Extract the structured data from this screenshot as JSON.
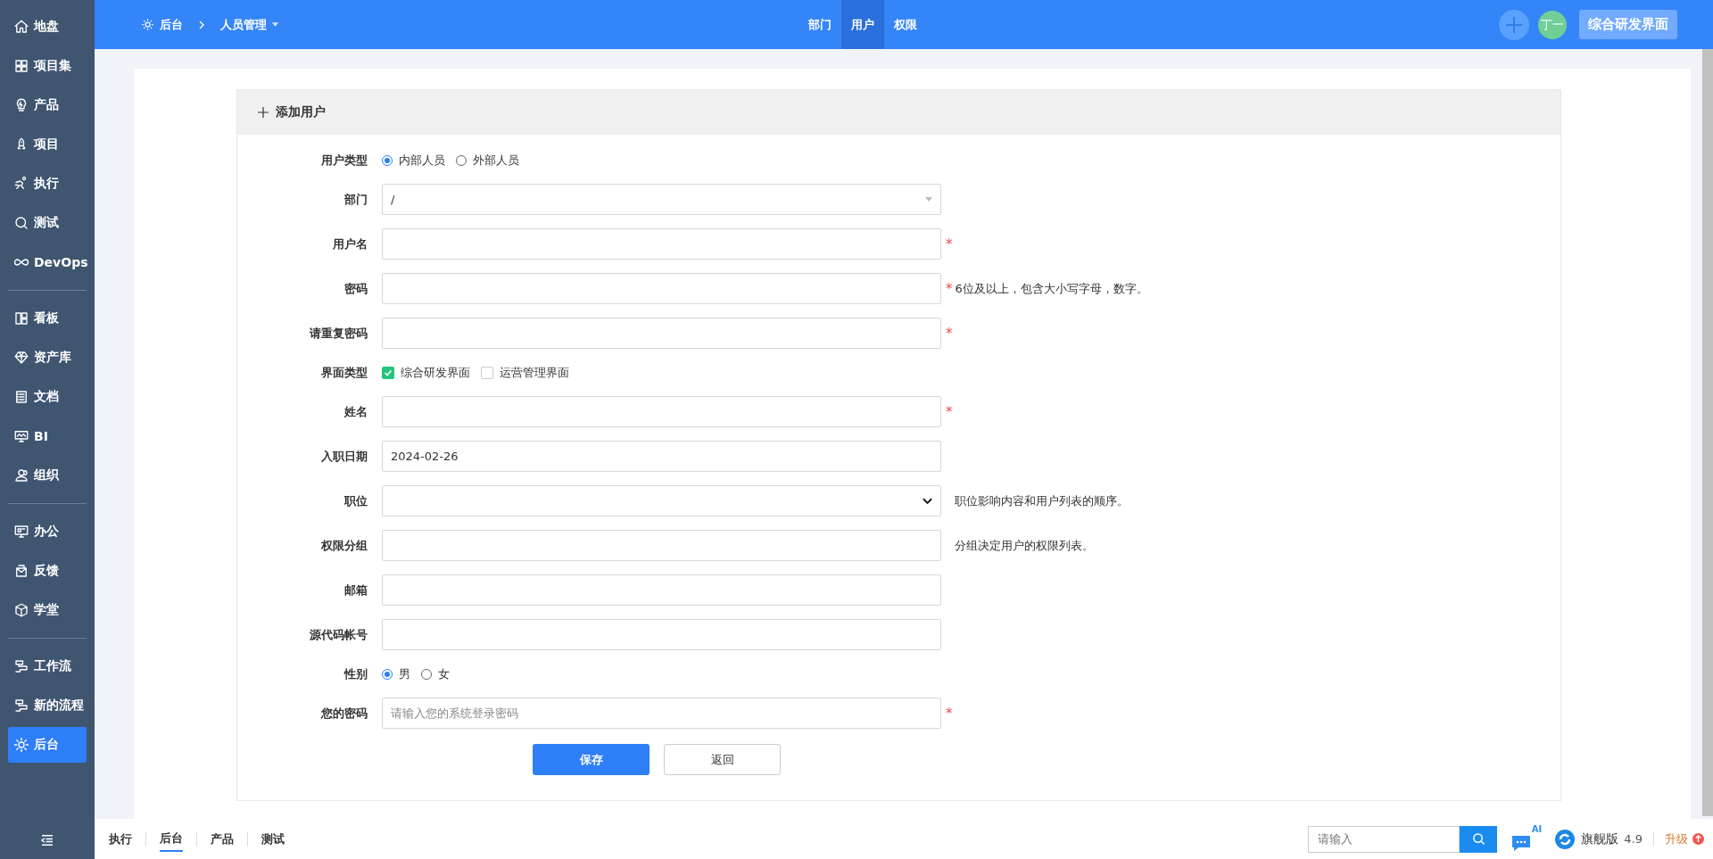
{
  "sidebar": {
    "groups": [
      [
        {
          "label": "地盘",
          "selected": false
        },
        {
          "label": "项目集",
          "selected": false
        },
        {
          "label": "产品",
          "selected": false
        },
        {
          "label": "项目",
          "selected": false
        },
        {
          "label": "执行",
          "selected": false
        },
        {
          "label": "测试",
          "selected": false
        },
        {
          "label": "DevOps",
          "selected": false
        }
      ],
      [
        {
          "label": "看板",
          "selected": false
        },
        {
          "label": "资产库",
          "selected": false
        },
        {
          "label": "文档",
          "selected": false
        },
        {
          "label": "BI",
          "selected": false
        },
        {
          "label": "组织",
          "selected": false
        }
      ],
      [
        {
          "label": "办公",
          "selected": false
        },
        {
          "label": "反馈",
          "selected": false
        },
        {
          "label": "学堂",
          "selected": false
        }
      ],
      [
        {
          "label": "工作流",
          "selected": false
        },
        {
          "label": "新的流程",
          "selected": false
        },
        {
          "label": "后台",
          "selected": true
        }
      ]
    ]
  },
  "topbar": {
    "breadcrumb": [
      "后台",
      "人员管理"
    ],
    "tabs": [
      {
        "label": "部门",
        "selected": false
      },
      {
        "label": "用户",
        "selected": true
      },
      {
        "label": "权限",
        "selected": false
      }
    ],
    "avatar": "丁一",
    "interface_button": "综合研发界面"
  },
  "form": {
    "title": "添加用户",
    "fields": [
      {
        "kind": "radio",
        "label": "用户类型",
        "options": [
          {
            "label": "内部人员",
            "selected": true
          },
          {
            "label": "外部人员",
            "selected": false
          }
        ]
      },
      {
        "kind": "select",
        "label": "部门",
        "value": "/"
      },
      {
        "kind": "text",
        "label": "用户名",
        "required_mark": "*"
      },
      {
        "kind": "text",
        "label": "密码",
        "required_mark": "*",
        "hint": "6位及以上，包含大小写字母，数字。"
      },
      {
        "kind": "text",
        "label": "请重复密码",
        "required_mark": "*"
      },
      {
        "kind": "checkbox",
        "label": "界面类型",
        "options": [
          {
            "label": "综合研发界面",
            "checked": true
          },
          {
            "label": "运营管理界面",
            "checked": false
          }
        ]
      },
      {
        "kind": "text",
        "label": "姓名",
        "required_mark": "*"
      },
      {
        "kind": "text",
        "label": "入职日期",
        "value": "2024-02-26"
      },
      {
        "kind": "dropdown",
        "label": "职位",
        "hint": "职位影响内容和用户列表的顺序。"
      },
      {
        "kind": "text",
        "label": "权限分组",
        "hint": "分组决定用户的权限列表。"
      },
      {
        "kind": "text",
        "label": "邮箱"
      },
      {
        "kind": "text",
        "label": "源代码帐号"
      },
      {
        "kind": "radio",
        "label": "性别",
        "options": [
          {
            "label": "男",
            "selected": true
          },
          {
            "label": "女",
            "selected": false
          }
        ]
      },
      {
        "kind": "text",
        "label": "您的密码",
        "required_mark": "*",
        "placeholder": "请输入您的系统登录密码"
      }
    ],
    "buttons": {
      "save": "保存",
      "back": "返回"
    }
  },
  "bottombar": {
    "tabs": [
      {
        "label": "执行",
        "selected": false
      },
      {
        "label": "后台",
        "selected": true
      },
      {
        "label": "产品",
        "selected": false
      },
      {
        "label": "测试",
        "selected": false
      }
    ],
    "search": {
      "placeholder": "请输入"
    },
    "ai_badge": "AI",
    "edition": "旗舰版",
    "version": "4.9",
    "upgrade": "升级"
  }
}
